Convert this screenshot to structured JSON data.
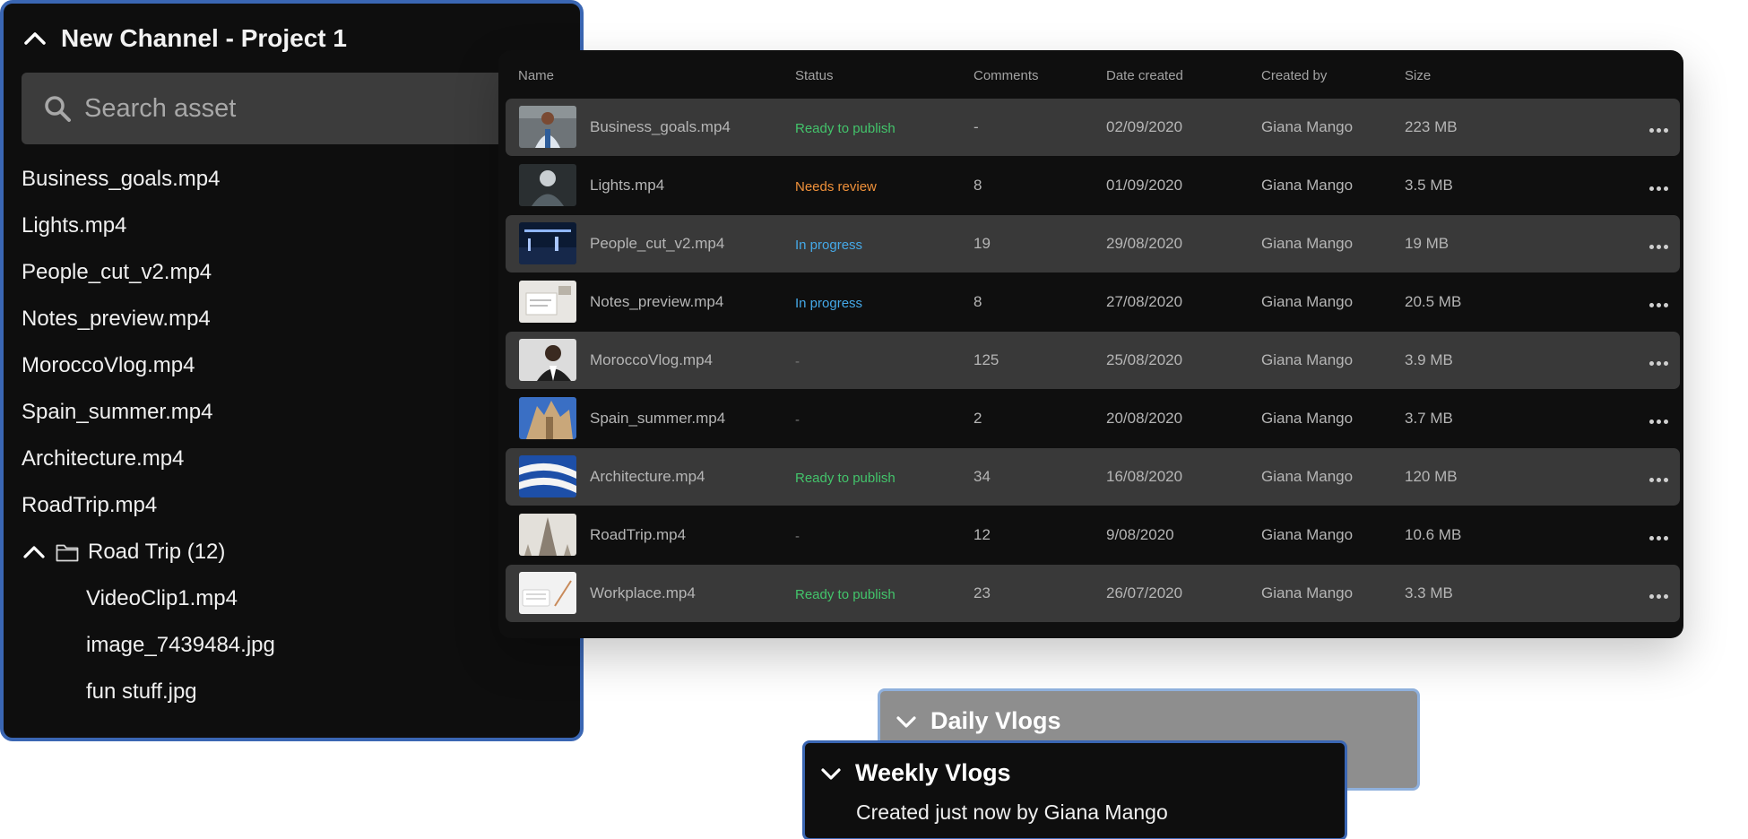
{
  "project": {
    "title": "New Channel - Project 1",
    "search_placeholder": "Search asset",
    "files": [
      "Business_goals.mp4",
      "Lights.mp4",
      "People_cut_v2.mp4",
      "Notes_preview.mp4",
      "MoroccoVlog.mp4",
      "Spain_summer.mp4",
      "Architecture.mp4",
      "RoadTrip.mp4"
    ],
    "folder": {
      "label": "Road Trip (12)",
      "items": [
        "VideoClip1.mp4",
        "image_7439484.jpg",
        "fun stuff.jpg"
      ]
    }
  },
  "table": {
    "columns": [
      "Name",
      "Status",
      "Comments",
      "Date created",
      "Created by",
      "Size"
    ],
    "rows": [
      {
        "name": "Business_goals.mp4",
        "status": "Ready to publish",
        "status_color": "#43c46b",
        "comments": "-",
        "date": "02/09/2020",
        "created_by": "Giana Mango",
        "size": "223 MB"
      },
      {
        "name": "Lights.mp4",
        "status": "Needs review",
        "status_color": "#f0913a",
        "comments": "8",
        "date": "01/09/2020",
        "created_by": "Giana Mango",
        "size": "3.5 MB"
      },
      {
        "name": "People_cut_v2.mp4",
        "status": "In progress",
        "status_color": "#45a9e8",
        "comments": "19",
        "date": "29/08/2020",
        "created_by": "Giana Mango",
        "size": "19 MB"
      },
      {
        "name": "Notes_preview.mp4",
        "status": "In progress",
        "status_color": "#45a9e8",
        "comments": "8",
        "date": "27/08/2020",
        "created_by": "Giana Mango",
        "size": "20.5 MB"
      },
      {
        "name": "MoroccoVlog.mp4",
        "status": "-",
        "status_color": "#7a7a7a",
        "comments": "125",
        "date": "25/08/2020",
        "created_by": "Giana Mango",
        "size": "3.9 MB"
      },
      {
        "name": "Spain_summer.mp4",
        "status": "-",
        "status_color": "#7a7a7a",
        "comments": "2",
        "date": "20/08/2020",
        "created_by": "Giana Mango",
        "size": "3.7 MB"
      },
      {
        "name": "Architecture.mp4",
        "status": "Ready to publish",
        "status_color": "#43c46b",
        "comments": "34",
        "date": "16/08/2020",
        "created_by": "Giana Mango",
        "size": "120 MB"
      },
      {
        "name": "RoadTrip.mp4",
        "status": "-",
        "status_color": "#7a7a7a",
        "comments": "12",
        "date": "9/08/2020",
        "created_by": "Giana Mango",
        "size": "10.6 MB"
      },
      {
        "name": "Workplace.mp4",
        "status": "Ready to publish",
        "status_color": "#43c46b",
        "comments": "23",
        "date": "26/07/2020",
        "created_by": "Giana Mango",
        "size": "3.3 MB"
      }
    ]
  },
  "daily_vlogs": {
    "title": "Daily Vlogs"
  },
  "weekly_vlogs": {
    "title": "Weekly Vlogs",
    "subtitle": "Created just now by Giana Mango"
  },
  "colors": {
    "accent_border": "#3a66b3",
    "panel_bg": "#0e0e0e",
    "row_shade": "#393939"
  }
}
